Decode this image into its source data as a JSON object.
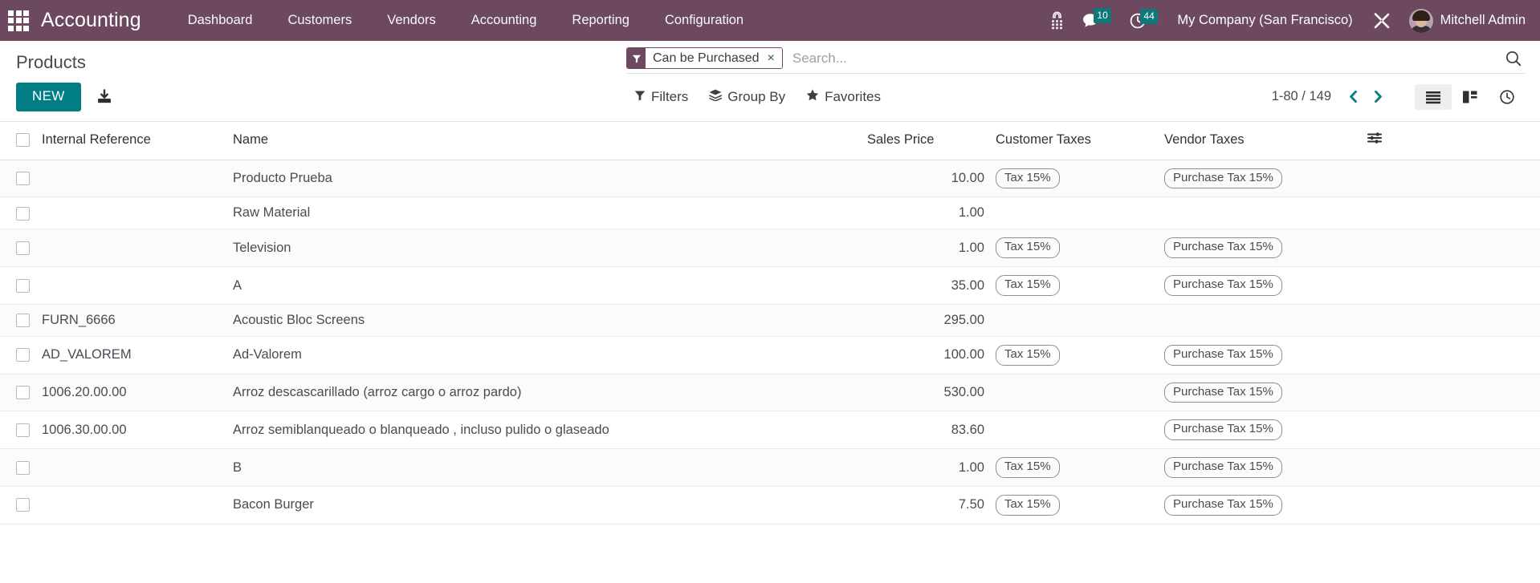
{
  "navbar": {
    "apps_icon": "apps-grid-icon",
    "brand": "Accounting",
    "menu": [
      {
        "label": "Dashboard"
      },
      {
        "label": "Customers"
      },
      {
        "label": "Vendors"
      },
      {
        "label": "Accounting"
      },
      {
        "label": "Reporting"
      },
      {
        "label": "Configuration"
      }
    ],
    "icons": {
      "voip_icon": "phone-dialpad-icon",
      "messages_icon": "chat-bubble-icon",
      "messages_count": "10",
      "activities_icon": "clock-icon",
      "activities_count": "44",
      "debug_icon": "tools-wrench-icon"
    },
    "company": "My Company (San Francisco)",
    "user": "Mitchell Admin",
    "avatar_icon": "user-avatar"
  },
  "control_panel": {
    "breadcrumb": "Products",
    "new_label": "NEW",
    "import_icon": "import-download-icon",
    "search": {
      "facet_icon": "filter-funnel-icon",
      "facet_label": "Can be Purchased",
      "facet_close": "×",
      "placeholder": "Search...",
      "value": "",
      "submit_icon": "search-icon"
    },
    "tools": [
      {
        "label": "Filters",
        "icon": "filter-funnel-icon"
      },
      {
        "label": "Group By",
        "icon": "layers-icon"
      },
      {
        "label": "Favorites",
        "icon": "star-icon"
      }
    ],
    "pager": {
      "value": "1-80 / 149",
      "previous_icon": "chevron-left-icon",
      "next_icon": "chevron-right-icon"
    },
    "views": [
      {
        "name": "list",
        "icon": "list-view-icon",
        "active": true
      },
      {
        "name": "kanban",
        "icon": "kanban-view-icon",
        "active": false
      },
      {
        "name": "activity",
        "icon": "activity-clock-icon",
        "active": false
      }
    ]
  },
  "table": {
    "columns": {
      "select_all": "select-all-checkbox",
      "internal_reference": "Internal Reference",
      "name": "Name",
      "sales_price": "Sales Price",
      "customer_taxes": "Customer Taxes",
      "vendor_taxes": "Vendor Taxes",
      "optional_icon": "column-options-icon"
    },
    "rows": [
      {
        "ref": "",
        "name": "Producto Prueba",
        "price": "10.00",
        "customer_tax": "Tax 15%",
        "vendor_tax": "Purchase Tax 15%"
      },
      {
        "ref": "",
        "name": "Raw Material",
        "price": "1.00",
        "customer_tax": "",
        "vendor_tax": ""
      },
      {
        "ref": "",
        "name": "Television",
        "price": "1.00",
        "customer_tax": "Tax 15%",
        "vendor_tax": "Purchase Tax 15%"
      },
      {
        "ref": "",
        "name": "A",
        "price": "35.00",
        "customer_tax": "Tax 15%",
        "vendor_tax": "Purchase Tax 15%"
      },
      {
        "ref": "FURN_6666",
        "name": "Acoustic Bloc Screens",
        "price": "295.00",
        "customer_tax": "",
        "vendor_tax": ""
      },
      {
        "ref": "AD_VALOREM",
        "name": "Ad-Valorem",
        "price": "100.00",
        "customer_tax": "Tax 15%",
        "vendor_tax": "Purchase Tax 15%"
      },
      {
        "ref": "1006.20.00.00",
        "name": "Arroz descascarillado (arroz cargo o arroz pardo)",
        "price": "530.00",
        "customer_tax": "",
        "vendor_tax": "Purchase Tax 15%"
      },
      {
        "ref": "1006.30.00.00",
        "name": "Arroz semiblanqueado o blanqueado , incluso pulido o glaseado",
        "price": "83.60",
        "customer_tax": "",
        "vendor_tax": "Purchase Tax 15%"
      },
      {
        "ref": "",
        "name": "B",
        "price": "1.00",
        "customer_tax": "Tax 15%",
        "vendor_tax": "Purchase Tax 15%"
      },
      {
        "ref": "",
        "name": "Bacon Burger",
        "price": "7.50",
        "customer_tax": "Tax 15%",
        "vendor_tax": "Purchase Tax 15%"
      }
    ]
  },
  "colors": {
    "navbar": "#6d4960",
    "accent_teal": "#017e84",
    "badge_teal": "#0f7878"
  }
}
